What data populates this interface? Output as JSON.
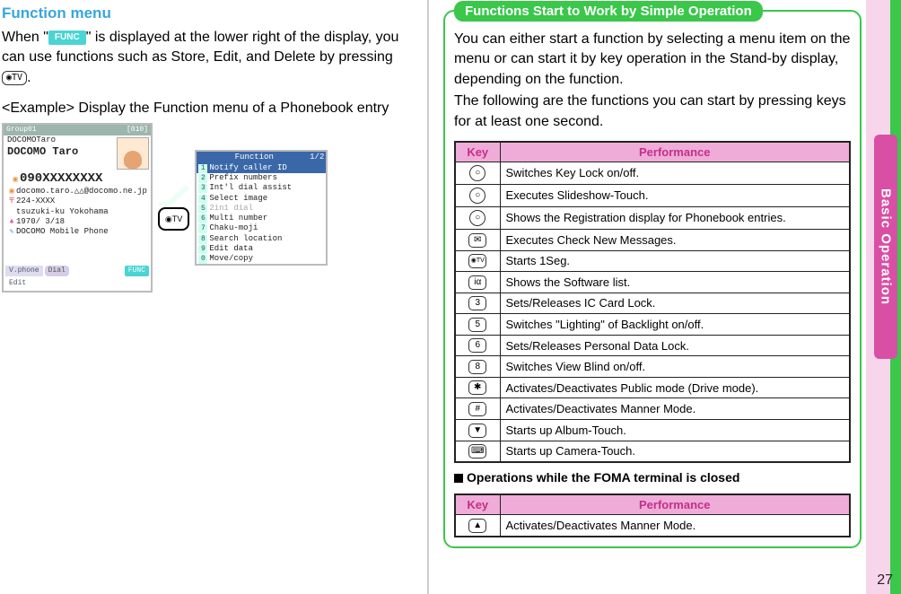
{
  "left": {
    "heading": "Function menu",
    "para_before_badge": "When \"",
    "badge_label": "FUNC",
    "para_after_badge": "\" is displayed at the lower right of the display, you can use functions such as Store, Edit, and Delete by pressing ",
    "key_label": "◉TV",
    "para_end": ".",
    "example_label": "<Example> Display the Function menu of a Phonebook entry",
    "phone1": {
      "title_left": "Group01",
      "title_right": "[010]",
      "line1": "DOCOMOTaro",
      "line2": "DOCOMO Taro",
      "number": "090XXXXXXXX",
      "email": "docomo.taro.△△@docomo.ne.jp",
      "tel": "224-XXXX",
      "addr": "tsuzuki-ku Yokohama",
      "date": "1970/ 3/18",
      "note": "DOCOMO Mobile Phone",
      "footer": {
        "vphone": "V.phone",
        "edit": "Edit",
        "dial": "Dial",
        "func": "FUNC"
      }
    },
    "cam_key_label": "◉TV",
    "phone2": {
      "title": "Function",
      "page": "1/2",
      "items": [
        "Notify caller ID",
        "Prefix numbers",
        "Int'l dial assist",
        "Select image",
        "2in1 dial",
        "Multi number",
        "Chaku-moji",
        "Search location",
        "Edit data",
        "Move/copy"
      ]
    }
  },
  "right": {
    "callout_title": "Functions Start to Work by Simple Operation",
    "intro_para": "You can either start a function by selecting a menu item on the menu or can start it by key operation in the Stand-by display, depending on the function.",
    "intro_para2": "The following are the functions you can start by pressing keys for at least one second.",
    "table_headers": {
      "key": "Key",
      "performance": "Performance"
    },
    "rows": [
      {
        "icon": "○",
        "text": "Switches Key Lock on/off."
      },
      {
        "icon": "○",
        "text": "Executes Slideshow-Touch."
      },
      {
        "icon": "○",
        "text": "Shows the Registration display for Phonebook entries."
      },
      {
        "icon": "✉",
        "text": "Executes Check New Messages."
      },
      {
        "icon": "◉TV",
        "text": "Starts 1Seg."
      },
      {
        "icon": "iα",
        "text": "Shows the Software list."
      },
      {
        "icon": "3",
        "text": "Sets/Releases IC Card Lock."
      },
      {
        "icon": "5",
        "text": "Switches \"Lighting\" of Backlight on/off."
      },
      {
        "icon": "6",
        "text": "Sets/Releases Personal Data Lock."
      },
      {
        "icon": "8",
        "text": "Switches View Blind on/off."
      },
      {
        "icon": "✱",
        "text": "Activates/Deactivates Public mode (Drive mode)."
      },
      {
        "icon": "#",
        "text": "Activates/Deactivates Manner Mode."
      },
      {
        "icon": "▼",
        "text": "Starts up Album-Touch."
      },
      {
        "icon": "⌨",
        "text": "Starts up Camera-Touch."
      }
    ],
    "subheading": "Operations while the FOMA terminal is closed",
    "rows2": [
      {
        "icon": "▲",
        "text": "Activates/Deactivates Manner Mode."
      }
    ]
  },
  "side_label": "Basic Operation",
  "page_number": "27"
}
